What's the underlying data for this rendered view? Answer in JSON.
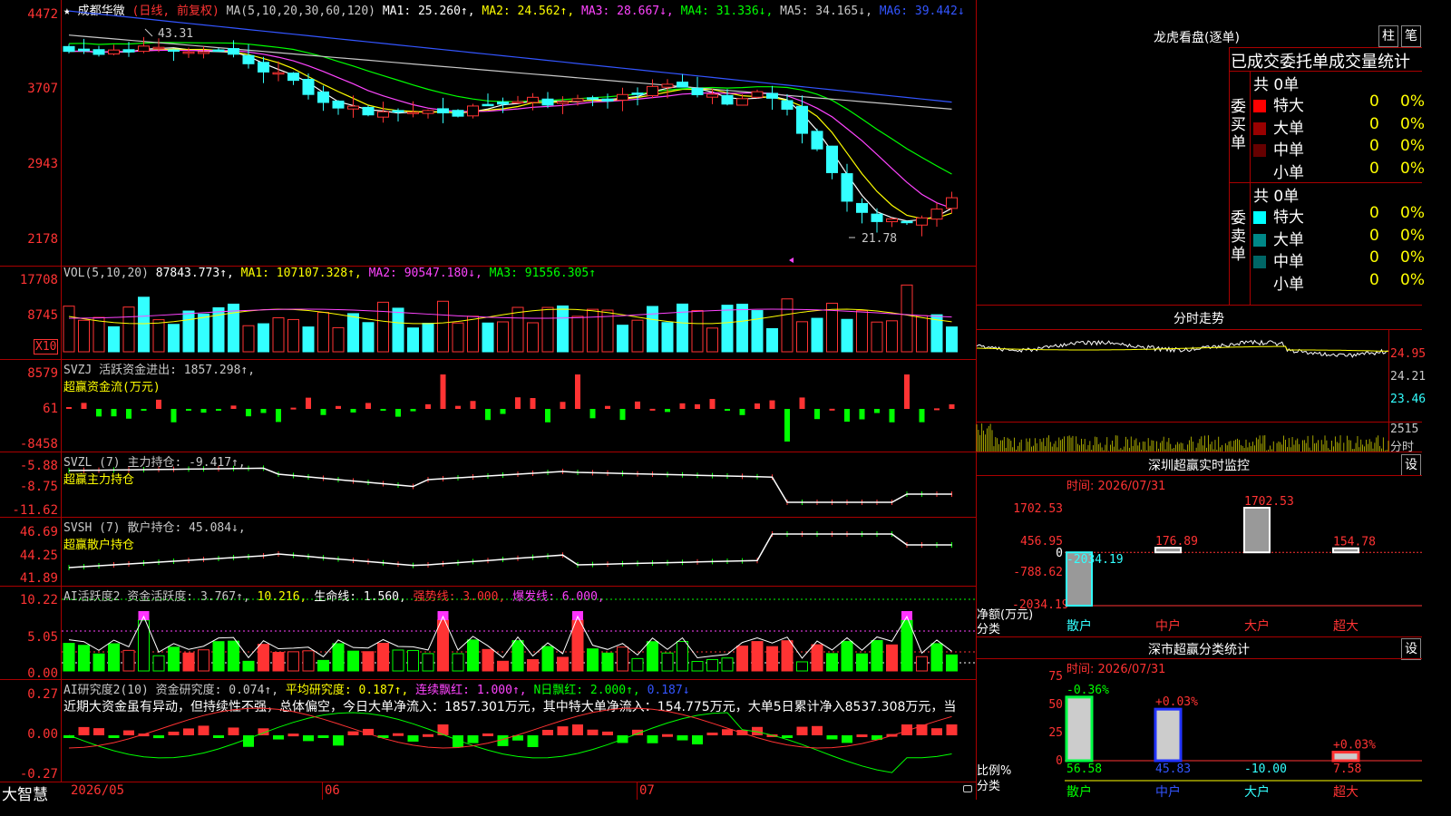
{
  "main_header": {
    "star": "★",
    "name": "成都华微",
    "period": "(日线, 前复权)",
    "ma_label": "MA(5,10,20,30,60,120)",
    "ma1": "MA1: 25.260↑,",
    "ma2": "MA2: 24.562↑,",
    "ma3": "MA3: 28.667↓,",
    "ma4": "MA4: 31.336↓,",
    "ma5": "MA5: 34.165↓,",
    "ma6": "MA6: 39.442↓"
  },
  "main_y": [
    "4472",
    "3707",
    "2943",
    "2178"
  ],
  "price_high": "43.31",
  "price_low": "21.78",
  "vol_header": {
    "label": "VOL(5,10,20)",
    "value": "87843.773↑,",
    "ma1": "MA1: 107107.328↑,",
    "ma2": "MA2: 90547.180↓,",
    "ma3": "MA3: 91556.305↑"
  },
  "vol_y": [
    "17708",
    "8745"
  ],
  "vol_unit": "X10",
  "svzj_header": {
    "line1": "SVZJ  活跃资金进出: 1857.298↑,",
    "line2": "超赢资金流(万元)"
  },
  "svzj_y": [
    "8579",
    "61",
    "-8458"
  ],
  "svzl_header": {
    "line1": "SVZL (7) 主力持仓: -9.417↑,",
    "line2": "超赢主力持仓"
  },
  "svzl_y": [
    "-5.88",
    "-8.75",
    "-11.62"
  ],
  "svsh_header": {
    "line1": "SVSH (7) 散户持仓: 45.084↓,",
    "line2": "超赢散户持仓"
  },
  "svsh_y": [
    "46.69",
    "44.25",
    "41.89"
  ],
  "ai1_header": {
    "label": "AI活跃度2 资金活跃度: 3.767↑,",
    "v2": "10.216,",
    "life": "生命线: 1.560,",
    "strong": "强势线: 3.000,",
    "burst": "爆发线: 6.000,"
  },
  "ai1_y": [
    "10.22",
    "5.05",
    "0.00"
  ],
  "ai2_header": {
    "label": "AI研究度2(10) 资金研究度: 0.074↑,",
    "avg": "平均研究度: 0.187↑,",
    "cont": "连续飘红: 1.000↑,",
    "nday": "N日飘红: 2.000↑,",
    "last": "0.187↓"
  },
  "ai2_text": "近期大资金虽有异动，但持续性不强，总体偏空，今日大单净流入：1857.301万元，其中特大单净流入：154.775万元，大单5日累计净入8537.308万元，当",
  "ai2_y": [
    "0.27",
    "0.00",
    "-0.27"
  ],
  "bottom": {
    "brand": "大智慧",
    "d1": "2026/05",
    "d2": "06",
    "d3": "07"
  },
  "right_top": {
    "title": "龙虎看盘(逐单)",
    "btn1": "柱",
    "btn2": "笔",
    "tab_title": "已成交委托单成交量统计",
    "buy_total": "共 0单",
    "buy_label": "委买单",
    "sell_total": "共 0单",
    "sell_label": "委卖单",
    "buy_rows": [
      {
        "name": "特大",
        "v": "0",
        "p": "0%",
        "color": "#ff0000"
      },
      {
        "name": "大单",
        "v": "0",
        "p": "0%",
        "color": "#990000"
      },
      {
        "name": "中单",
        "v": "0",
        "p": "0%",
        "color": "#660000"
      },
      {
        "name": "小单",
        "v": "0",
        "p": "0%",
        "color": ""
      }
    ],
    "sell_rows": [
      {
        "name": "特大",
        "v": "0",
        "p": "0%",
        "color": "#00ffff"
      },
      {
        "name": "大单",
        "v": "0",
        "p": "0%",
        "color": "#008888"
      },
      {
        "name": "中单",
        "v": "0",
        "p": "0%",
        "color": "#006666"
      },
      {
        "name": "小单",
        "v": "0",
        "p": "0%",
        "color": ""
      }
    ]
  },
  "intraday": {
    "title": "分时走势",
    "p1": "24.95",
    "p2": "24.21",
    "p3": "23.46",
    "vol": "2515",
    "unit": "分时"
  },
  "sz_monitor": {
    "title": "深圳超赢实时监控",
    "btn": "设",
    "time": "时间: 2026/07/31",
    "y": [
      "1702.53",
      "456.95",
      "0",
      "-788.62",
      "-2034.19"
    ],
    "ylabel1": "净额(万元)",
    "ylabel2": "分类",
    "categories": [
      "散户",
      "中户",
      "大户",
      "超大"
    ],
    "values": [
      -2034.19,
      176.89,
      1702.53,
      154.78
    ],
    "labels": [
      "-2034.19",
      "176.89",
      "1702.53",
      "154.78"
    ]
  },
  "sz_class": {
    "title": "深市超赢分类统计",
    "btn": "设",
    "time": "时间: 2026/07/31",
    "y": [
      "75",
      "50",
      "25",
      "0"
    ],
    "ylabel1": "比例%",
    "ylabel2": "分类",
    "categories": [
      "散户",
      "中户",
      "大户",
      "超大"
    ],
    "values": [
      56.58,
      45.83,
      -10.0,
      7.58
    ],
    "value_labels": [
      "56.58",
      "45.83",
      "-10.00",
      "7.58"
    ],
    "changes": [
      "-0.36%",
      "+0.03%",
      "",
      "+0.03%"
    ]
  },
  "chart_data": [
    {
      "type": "bar",
      "title": "深圳超赢实时监控",
      "categories": [
        "散户",
        "中户",
        "大户",
        "超大"
      ],
      "values": [
        -2034.19,
        176.89,
        1702.53,
        154.78
      ],
      "ylabel": "净额(万元)",
      "ylim": [
        -2034.19,
        1702.53
      ]
    },
    {
      "type": "bar",
      "title": "深市超赢分类统计",
      "categories": [
        "散户",
        "中户",
        "大户",
        "超大"
      ],
      "values": [
        56.58,
        45.83,
        -10.0,
        7.58
      ],
      "ylabel": "比例%",
      "ylim": [
        0,
        75
      ]
    }
  ]
}
